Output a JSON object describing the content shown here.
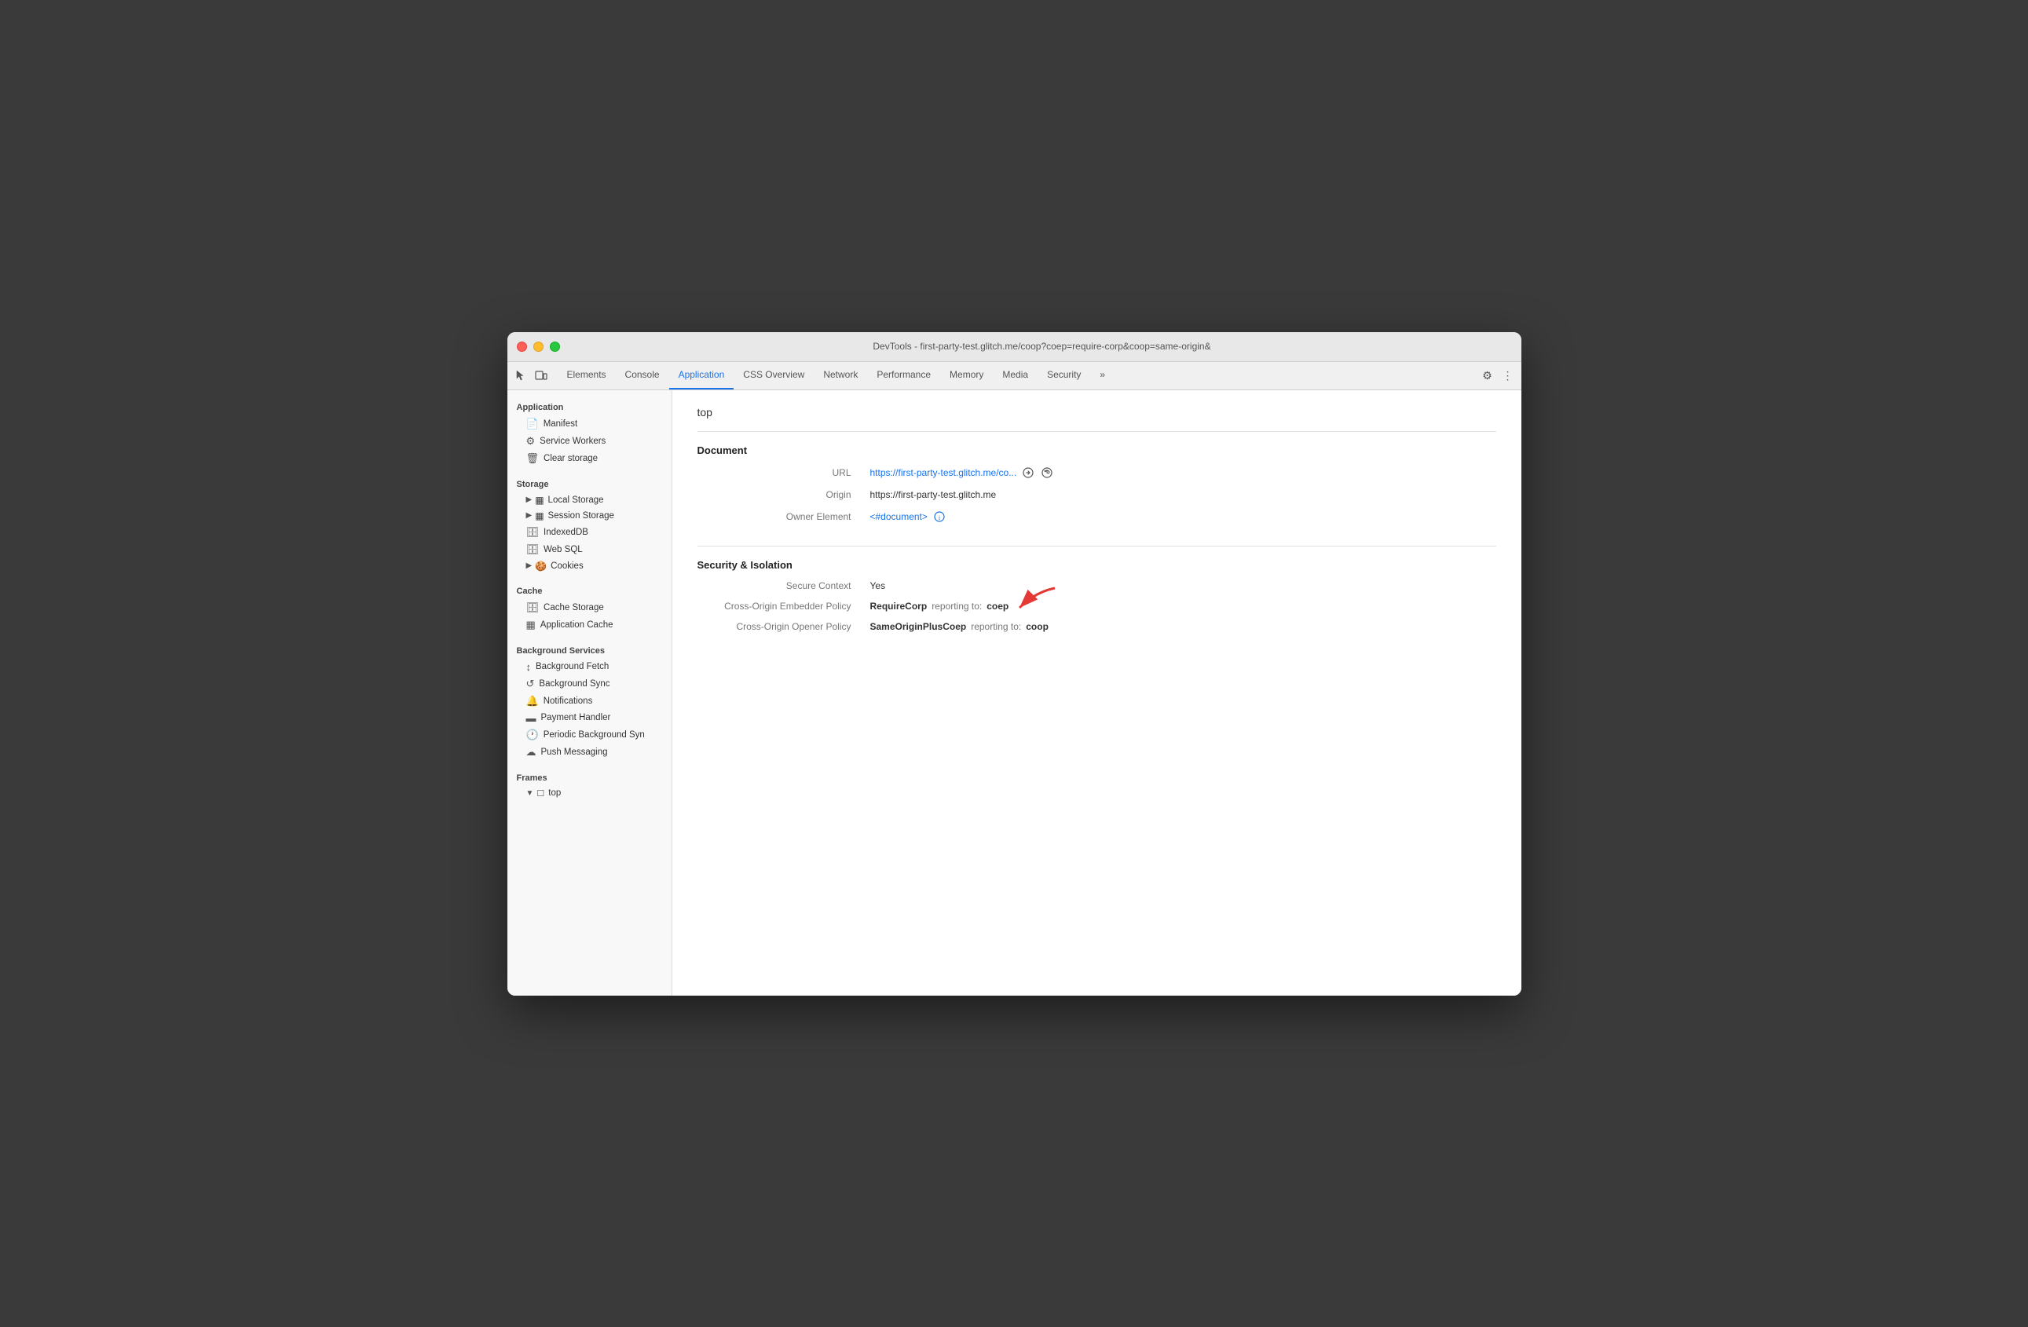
{
  "window": {
    "title": "DevTools - first-party-test.glitch.me/coop?coep=require-corp&coop=same-origin&"
  },
  "tabs": [
    {
      "id": "elements",
      "label": "Elements",
      "active": false
    },
    {
      "id": "console",
      "label": "Console",
      "active": false
    },
    {
      "id": "application",
      "label": "Application",
      "active": true
    },
    {
      "id": "css-overview",
      "label": "CSS Overview",
      "active": false
    },
    {
      "id": "network",
      "label": "Network",
      "active": false
    },
    {
      "id": "performance",
      "label": "Performance",
      "active": false
    },
    {
      "id": "memory",
      "label": "Memory",
      "active": false
    },
    {
      "id": "media",
      "label": "Media",
      "active": false
    },
    {
      "id": "security",
      "label": "Security",
      "active": false
    },
    {
      "id": "more",
      "label": "»",
      "active": false
    }
  ],
  "sidebar": {
    "sections": [
      {
        "id": "application",
        "label": "Application",
        "items": [
          {
            "id": "manifest",
            "label": "Manifest",
            "icon": "📄",
            "indent": 1
          },
          {
            "id": "service-workers",
            "label": "Service Workers",
            "icon": "⚙",
            "indent": 1
          },
          {
            "id": "clear-storage",
            "label": "Clear storage",
            "icon": "🗑",
            "indent": 1
          }
        ]
      },
      {
        "id": "storage",
        "label": "Storage",
        "items": [
          {
            "id": "local-storage",
            "label": "Local Storage",
            "icon": "▶",
            "iconType": "expand",
            "indent": 1
          },
          {
            "id": "session-storage",
            "label": "Session Storage",
            "icon": "▶",
            "iconType": "expand",
            "indent": 1
          },
          {
            "id": "indexeddb",
            "label": "IndexedDB",
            "icon": "🗄",
            "indent": 1
          },
          {
            "id": "web-sql",
            "label": "Web SQL",
            "icon": "🗄",
            "indent": 1
          },
          {
            "id": "cookies",
            "label": "Cookies",
            "icon": "▶",
            "iconType": "expand",
            "indent": 1
          }
        ]
      },
      {
        "id": "cache",
        "label": "Cache",
        "items": [
          {
            "id": "cache-storage",
            "label": "Cache Storage",
            "icon": "🗄",
            "indent": 1
          },
          {
            "id": "application-cache",
            "label": "Application Cache",
            "icon": "▦",
            "indent": 1
          }
        ]
      },
      {
        "id": "background-services",
        "label": "Background Services",
        "items": [
          {
            "id": "background-fetch",
            "label": "Background Fetch",
            "icon": "↕",
            "indent": 1
          },
          {
            "id": "background-sync",
            "label": "Background Sync",
            "icon": "↺",
            "indent": 1
          },
          {
            "id": "notifications",
            "label": "Notifications",
            "icon": "🔔",
            "indent": 1
          },
          {
            "id": "payment-handler",
            "label": "Payment Handler",
            "icon": "▬",
            "indent": 1
          },
          {
            "id": "periodic-background-sync",
            "label": "Periodic Background Syn",
            "icon": "🕐",
            "indent": 1
          },
          {
            "id": "push-messaging",
            "label": "Push Messaging",
            "icon": "☁",
            "indent": 1
          }
        ]
      },
      {
        "id": "frames",
        "label": "Frames",
        "items": [
          {
            "id": "top-frame",
            "label": "top",
            "icon": "▼",
            "iconType": "expanded",
            "indent": 1
          }
        ]
      }
    ]
  },
  "content": {
    "page_title": "top",
    "sections": [
      {
        "id": "document",
        "title": "Document",
        "fields": [
          {
            "label": "URL",
            "value": "https://first-party-test.glitch.me/co...",
            "type": "link-with-icons"
          },
          {
            "label": "Origin",
            "value": "https://first-party-test.glitch.me",
            "type": "text"
          },
          {
            "label": "Owner Element",
            "value": "<#document>",
            "type": "link-with-icon"
          }
        ]
      },
      {
        "id": "security-isolation",
        "title": "Security & Isolation",
        "fields": [
          {
            "label": "Secure Context",
            "value": "Yes",
            "type": "text"
          },
          {
            "label": "Cross-Origin Embedder Policy",
            "value": "RequireCorp",
            "type": "policy",
            "reporting_label": "reporting to:",
            "reporting_value": "coep",
            "has_arrow": true
          },
          {
            "label": "Cross-Origin Opener Policy",
            "value": "SameOriginPlusCoep",
            "type": "policy",
            "reporting_label": "reporting to:",
            "reporting_value": "coop",
            "has_arrow": false
          }
        ]
      }
    ]
  }
}
